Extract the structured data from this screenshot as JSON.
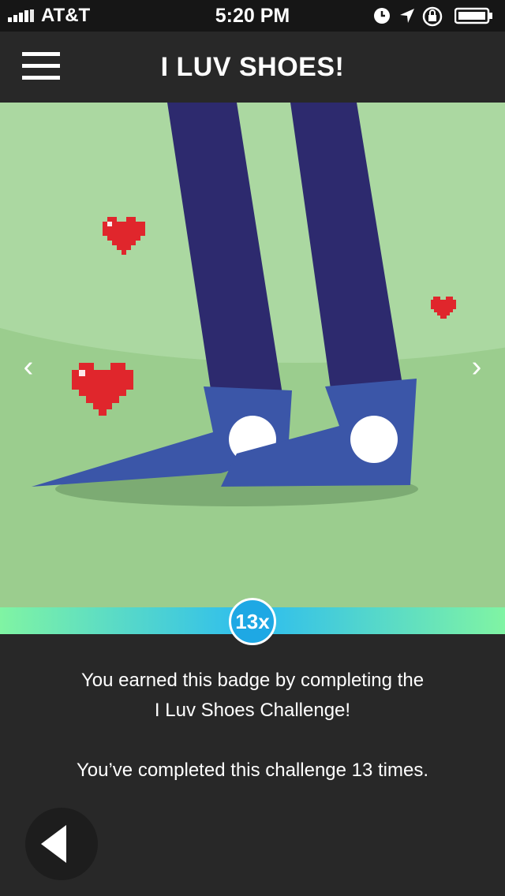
{
  "status_bar": {
    "carrier": "AT&T",
    "time": "5:20 PM"
  },
  "header": {
    "title": "I LUV SHOES!"
  },
  "carousel": {
    "prev_glyph": "‹",
    "next_glyph": "›"
  },
  "badge": {
    "count_label": "13x",
    "progress_fraction": 1.0
  },
  "description": {
    "line1": "You earned this badge by completing the",
    "line2": "I Luv Shoes Challenge!",
    "completion_text": "You’ve completed this challenge 13 times."
  },
  "colors": {
    "background": "#282828",
    "grass": "#9bcd8e",
    "pants": "#2d2a6e",
    "shoes": "#3b56a8",
    "heart": "#e0262c",
    "badge": "#1ea8e4"
  },
  "icons": {
    "menu": "menu-icon",
    "back": "back-arrow-icon",
    "prev": "chevron-left-icon",
    "next": "chevron-right-icon"
  }
}
